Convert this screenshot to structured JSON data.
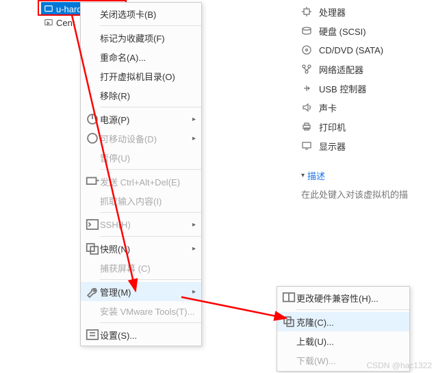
{
  "tree": {
    "item1": {
      "label": "u-hard"
    },
    "item2": {
      "label": "Cent"
    }
  },
  "menu": {
    "close_tab": "关闭选项卡(B)",
    "favorite": "标记为收藏项(F)",
    "rename": "重命名(A)...",
    "open_dir": "打开虚拟机目录(O)",
    "remove": "移除(R)",
    "power": "电源(P)",
    "removable": "可移动设备(D)",
    "pause": "暂停(U)",
    "send_cad": "发送 Ctrl+Alt+Del(E)",
    "grab_input": "抓取输入内容(I)",
    "ssh": "SSH(H)",
    "snapshot": "快照(N)",
    "capture": "捕获屏幕 (C)",
    "manage": "管理(M)",
    "install_tools": "安装 VMware Tools(T)...",
    "settings": "设置(S)..."
  },
  "submenu": {
    "compat": "更改硬件兼容性(H)...",
    "clone": "克隆(C)...",
    "upload": "上载(U)...",
    "download": "下载(W)..."
  },
  "hardware": {
    "cpu": "处理器",
    "disk": "硬盘 (SCSI)",
    "cd": "CD/DVD (SATA)",
    "net": "网络适配器",
    "usb": "USB 控制器",
    "sound": "声卡",
    "printer": "打印机",
    "display": "显示器"
  },
  "desc": {
    "header": "描述",
    "placeholder": "在此处键入对该虚拟机的描"
  },
  "watermark": "CSDN @hac1322"
}
